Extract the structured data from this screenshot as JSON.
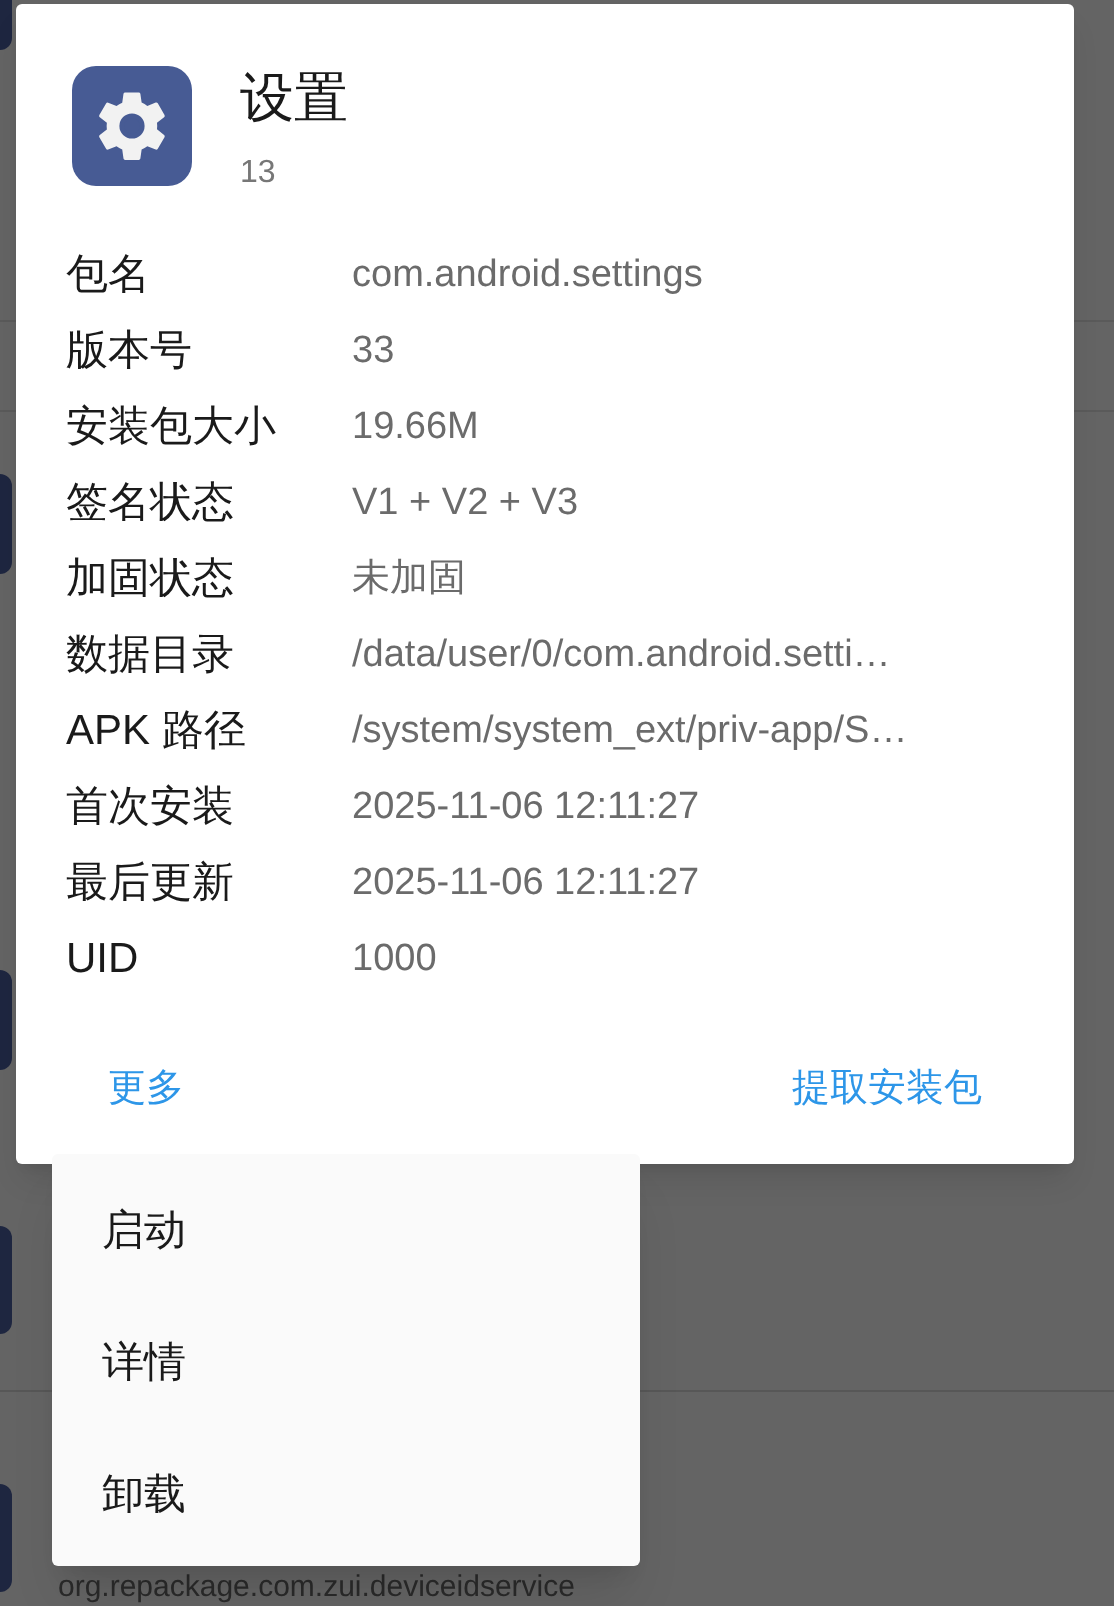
{
  "dialog": {
    "title": "设置",
    "subtitle": "13",
    "fields": [
      {
        "label": "包名",
        "value": "com.android.settings"
      },
      {
        "label": "版本号",
        "value": "33"
      },
      {
        "label": "安装包大小",
        "value": "19.66M"
      },
      {
        "label": "签名状态",
        "value": "V1 + V2 + V3"
      },
      {
        "label": "加固状态",
        "value": "未加固"
      },
      {
        "label": "数据目录",
        "value": "/data/user/0/com.android.setti…"
      },
      {
        "label": "APK 路径",
        "value": "/system/system_ext/priv-app/S…"
      },
      {
        "label": "首次安装",
        "value": "2025-11-06 12:11:27"
      },
      {
        "label": "最后更新",
        "value": "2025-11-06 12:11:27"
      },
      {
        "label": "UID",
        "value": "1000"
      }
    ],
    "buttons": [
      "更多",
      "提取安装包"
    ]
  },
  "menu": {
    "items": [
      "启动",
      "详情",
      "卸载"
    ]
  },
  "background": {
    "package_name": "org.repackage.com.zui.deviceidservice"
  }
}
